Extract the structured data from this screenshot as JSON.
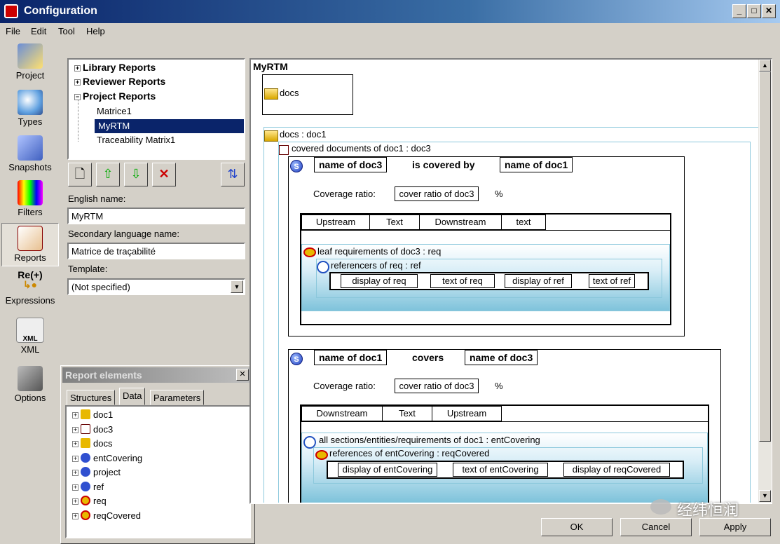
{
  "window": {
    "title": "Configuration"
  },
  "menu": [
    "File",
    "Edit",
    "Tool",
    "Help"
  ],
  "nav": [
    {
      "label": "Project",
      "icon": "project-icon"
    },
    {
      "label": "Types",
      "icon": "types-icon"
    },
    {
      "label": "Snapshots",
      "icon": "snapshots-icon"
    },
    {
      "label": "Filters",
      "icon": "filters-icon"
    },
    {
      "label": "Reports",
      "icon": "reports-icon"
    },
    {
      "label": "Expressions",
      "icon": "expressions-icon",
      "badge": "Re(+)"
    },
    {
      "label": "XML",
      "icon": "xml-icon",
      "badge": "XML"
    },
    {
      "label": "Options",
      "icon": "options-icon"
    }
  ],
  "tree": {
    "groups": [
      {
        "label": "Library Reports",
        "expander": "+"
      },
      {
        "label": "Reviewer Reports",
        "expander": "+"
      },
      {
        "label": "Project Reports",
        "expander": "−"
      }
    ],
    "children": [
      "Matrice1",
      "MyRTM",
      "Traceability Matrix1"
    ],
    "selected": "MyRTM"
  },
  "form": {
    "english_name_label": "English name:",
    "english_name_value": "MyRTM",
    "secondary_label": "Secondary language name:",
    "secondary_value": "Matrice de traçabilité",
    "template_label": "Template:",
    "template_value": "(Not specified)"
  },
  "report_elements": {
    "title": "Report elements",
    "close": "✕",
    "tabs": [
      "Structures",
      "Data",
      "Parameters"
    ],
    "active_tab": "Data",
    "items": [
      {
        "label": "doc1",
        "kind": "folder"
      },
      {
        "label": "doc3",
        "kind": "book"
      },
      {
        "label": "docs",
        "kind": "folder"
      },
      {
        "label": "entCovering",
        "kind": "variable"
      },
      {
        "label": "project",
        "kind": "variable"
      },
      {
        "label": "ref",
        "kind": "variable"
      },
      {
        "label": "req",
        "kind": "requirement"
      },
      {
        "label": "reqCovered",
        "kind": "requirement"
      }
    ]
  },
  "canvas": {
    "title": "MyRTM",
    "top_box": "docs",
    "docs_iter": "docs : doc1",
    "covered_iter": "covered documents of doc1 : doc3",
    "section1": {
      "s_badge": "S",
      "h1": "name of doc3",
      "h2": "is covered by",
      "h3": "name of doc1",
      "coverage_label": "Coverage ratio:",
      "coverage_value": "cover ratio of doc3",
      "percent": "%",
      "cols": [
        "Upstream",
        "Text",
        "Downstream",
        "text"
      ],
      "leaf": "leaf requirements of doc3 : req",
      "refs": "referencers of req : ref",
      "row": [
        "display of req",
        "text of req",
        "display of ref",
        "text of ref"
      ]
    },
    "section2": {
      "s_badge": "S",
      "h1": "name of doc1",
      "h2": "covers",
      "h3": "name of doc3",
      "coverage_label": "Coverage ratio:",
      "coverage_value": "cover ratio of doc3",
      "percent": "%",
      "cols": [
        "Downstream",
        "Text",
        "Upstream"
      ],
      "all": "all sections/entities/requirements of doc1 : entCovering",
      "refs": "references of entCovering : reqCovered",
      "row": [
        "display of entCovering",
        "text of entCovering",
        "display of reqCovered"
      ]
    }
  },
  "buttons": {
    "ok": "OK",
    "cancel": "Cancel",
    "apply": "Apply"
  },
  "watermark": "经纬恒润"
}
